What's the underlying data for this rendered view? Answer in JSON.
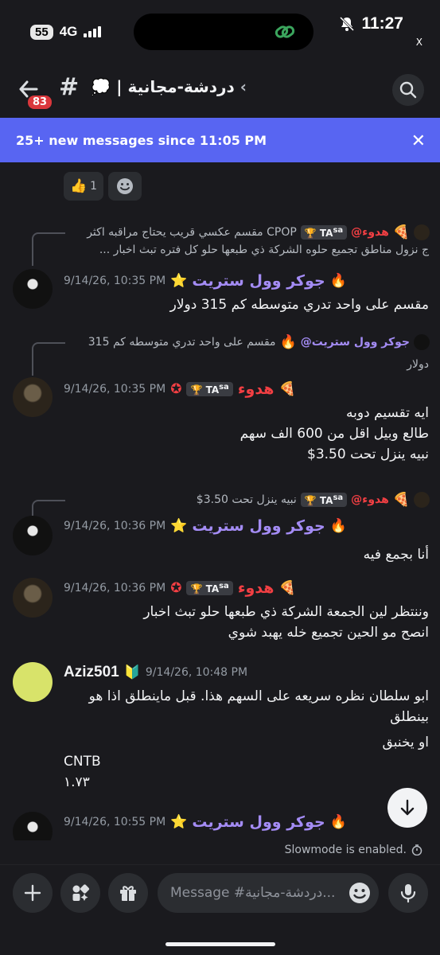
{
  "status_bar": {
    "battery": "55",
    "network": "4G",
    "time": "11:27",
    "close_small": "X"
  },
  "header": {
    "unread_badge": "83",
    "channel_hash": "#",
    "channel_name": "دردشة-مجانية | 💭",
    "chevron": "›"
  },
  "banner": {
    "text": "25+ new messages since 11:05 PM",
    "close": "✕"
  },
  "reactions": [
    {
      "emoji": "👍",
      "count": "1"
    }
  ],
  "messages": [
    {
      "reply_author": "@هدوء",
      "reply_tag": "TA",
      "reply_tag_sup": "sa",
      "reply_text": "CPOP مقسم عكسي قريب  يحتاج مراقبه اكثر",
      "reply_text2": "ج نزول مناطق تجميع حلوه  الشركة ذي طبعها حلو كل فتره تبث اخبار ...",
      "author": "جوكر وول ستريت",
      "time": "9/14/26, 10:35 PM",
      "lines": [
        "مقسم على واحد تدري متوسطه كم 315 دولار"
      ]
    },
    {
      "reply_author": "@جوكر وول ستريت",
      "reply_text": "مقسم على واحد تدري متوسطه كم 315",
      "reply_text2": "دولار",
      "author": "هدوء",
      "tag": "TA",
      "tag_sup": "sa",
      "time": "9/14/26, 10:35 PM",
      "lines": [
        "ايه تقسيم دوبه",
        "طالع وبيل اقل من 600 الف سهم",
        "نبيه ينزل تحت 3.50$"
      ]
    },
    {
      "reply_author": "@هدوء",
      "reply_tag": "TA",
      "reply_tag_sup": "sa",
      "reply_text": "نبيه ينزل تحت 3.50$",
      "author": "جوكر وول ستريت",
      "time": "9/14/26, 10:36 PM",
      "lines": [
        "أنا بجمع فيه"
      ]
    },
    {
      "author": "هدوء",
      "tag": "TA",
      "tag_sup": "sa",
      "time": "9/14/26, 10:36 PM",
      "lines": [
        "وننتظر لين الجمعة الشركة ذي طبعها حلو تبث اخبار",
        "انصح مو الحين تجميع خله يهبد شوي"
      ]
    },
    {
      "author": "Aziz501",
      "time": "9/14/26, 10:48 PM",
      "lines": [
        "ابو سلطان نظره سريعه على السهم هذا. قبل ماينطلق اذا هو بينطلق",
        "او يخنبق"
      ],
      "extra_lines": [
        "CNTB",
        "١.٧٣"
      ]
    },
    {
      "author": "جوكر وول ستريت",
      "time": "9/14/26, 10:55 PM",
      "lines": []
    }
  ],
  "slowmode": "Slowmode is enabled.",
  "composer": {
    "placeholder": "Message #دردشة-مجانية..."
  },
  "colors": {
    "accent": "#5865f2",
    "joker_name": "#a48cf5",
    "hudu_name": "#f23f43",
    "mention_badge": "#da373c"
  }
}
